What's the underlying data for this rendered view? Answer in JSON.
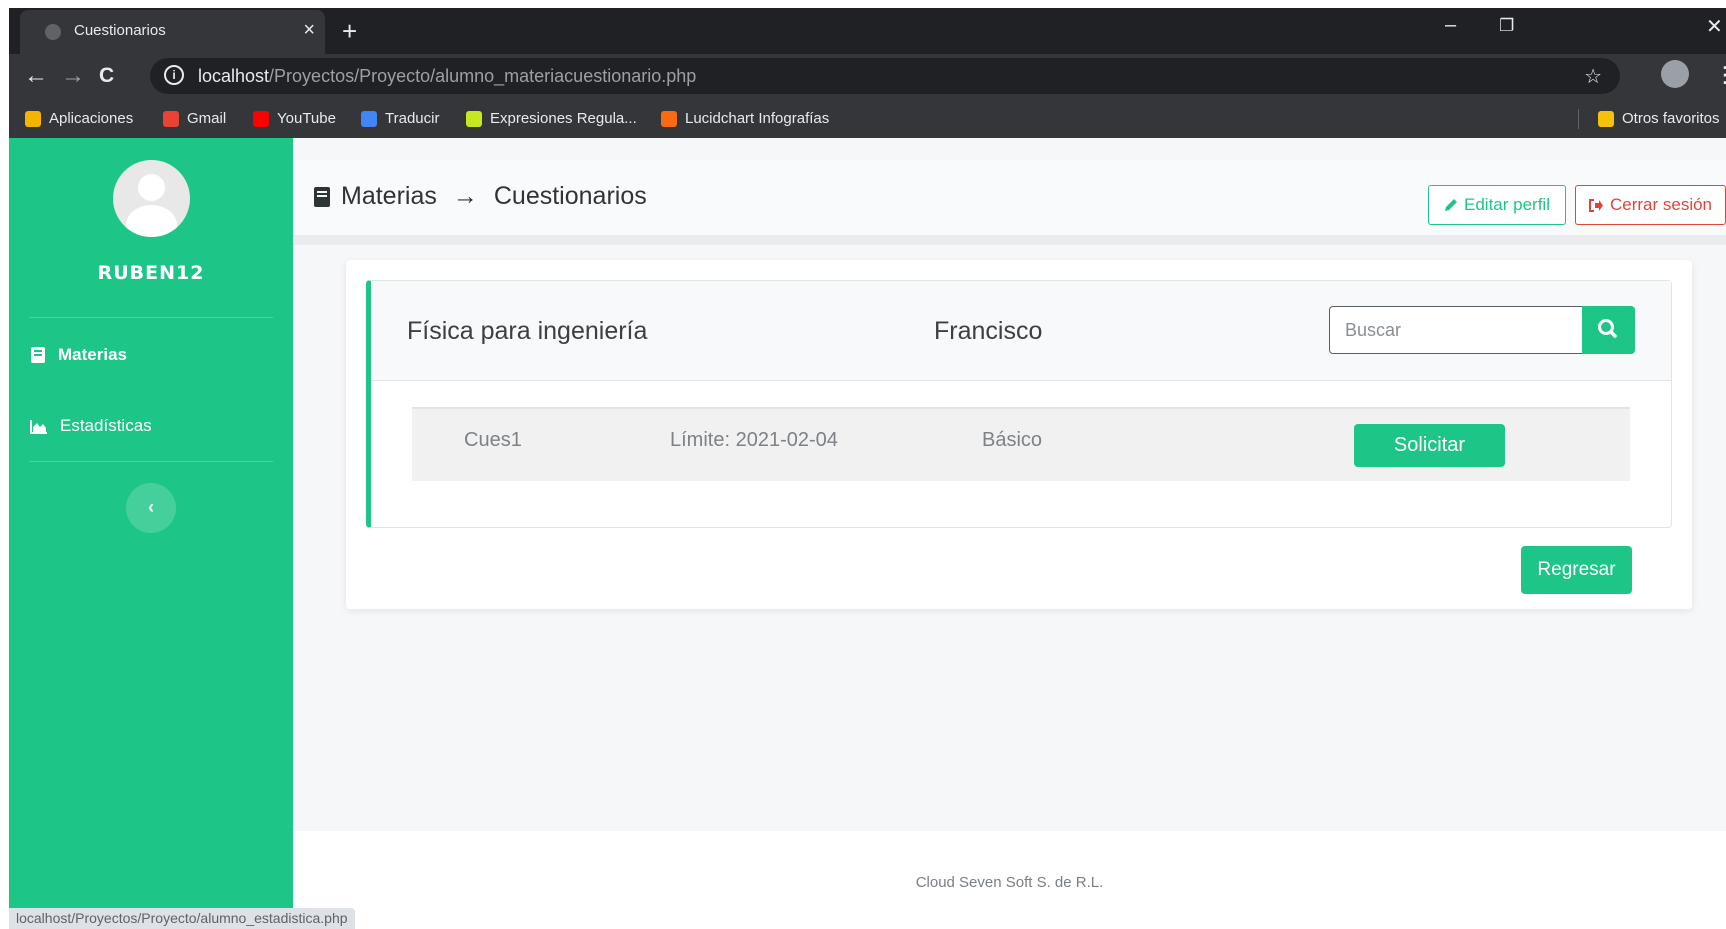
{
  "browser": {
    "tab_title": "Cuestionarios",
    "tab_close": "×",
    "new_tab": "+",
    "window_controls": {
      "minimize": "–",
      "restore": "❐",
      "close": "✕"
    },
    "nav": {
      "back": "←",
      "forward": "→",
      "reload": "C"
    },
    "url_host": "localhost",
    "url_path": "/Proyectos/Proyecto/alumno_materiacuestionario.php",
    "bookmarks": [
      {
        "label": "Aplicaciones",
        "icon": "apps-grid-icon",
        "color": "#f4b400"
      },
      {
        "label": "Gmail",
        "icon": "gmail-icon",
        "color": "#ea4335"
      },
      {
        "label": "YouTube",
        "icon": "youtube-icon",
        "color": "#ff0000"
      },
      {
        "label": "Traducir",
        "icon": "translate-icon",
        "color": "#4285f4"
      },
      {
        "label": "Expresiones Regula...",
        "icon": "regex-icon",
        "color": "#c6e820"
      },
      {
        "label": "Lucidchart Infografías",
        "icon": "lucidchart-icon",
        "color": "#f96b13"
      }
    ],
    "other_bookmarks": "Otros favoritos",
    "status_url": "localhost/Proyectos/Proyecto/alumno_estadistica.php"
  },
  "sidebar": {
    "username": "RUBEN12",
    "items": [
      {
        "label": "Materias",
        "icon": "book-icon",
        "active": true
      },
      {
        "label": "Estadísticas",
        "icon": "chart-area-icon",
        "active": false
      }
    ],
    "collapse_icon": "‹"
  },
  "header": {
    "crumb_first": "Materias",
    "crumb_arrow": "→",
    "crumb_second": "Cuestionarios",
    "edit_profile": "Editar perfil",
    "logout": "Cerrar sesión"
  },
  "card": {
    "subject": "Física para ingeniería",
    "teacher": "Francisco",
    "search_placeholder": "Buscar",
    "rows": [
      {
        "name": "Cues1",
        "limit": "Límite: 2021-02-04",
        "level": "Básico",
        "action": "Solicitar"
      }
    ]
  },
  "back_button": "Regresar",
  "footer": "Cloud Seven Soft S. de R.L.",
  "colors": {
    "primary": "#1dc686",
    "danger": "#e0453a",
    "chrome": "#202124"
  }
}
